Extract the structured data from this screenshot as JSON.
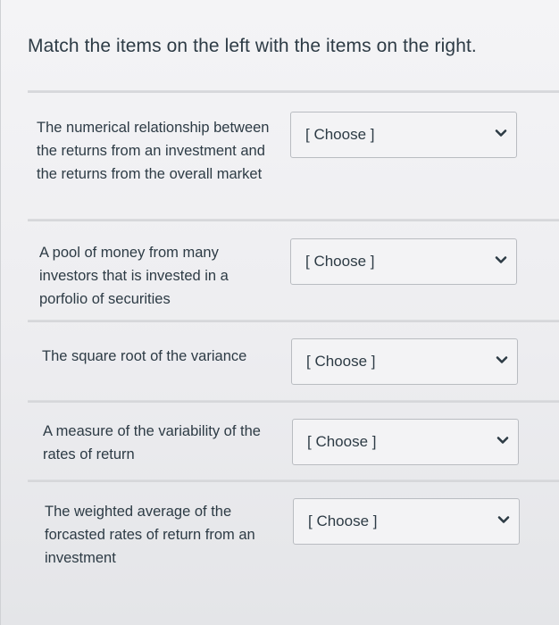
{
  "question_text": "Match the items on the left with the items on the right.",
  "rows": [
    {
      "prompt": "The numerical relationship between the returns from an investment and the returns from the overall market",
      "select_value": "[ Choose ]"
    },
    {
      "prompt": "A pool of money from many investors that is invested in a porfolio of securities",
      "select_value": "[ Choose ]"
    },
    {
      "prompt": "The square root of the variance",
      "select_value": "[ Choose ]"
    },
    {
      "prompt": "A measure of the variability of the rates of return",
      "select_value": "[ Choose ]"
    },
    {
      "prompt": "The weighted average of the forcasted rates of return from an investment",
      "select_value": "[ Choose ]"
    }
  ],
  "icons": {
    "dropdown": "chevron-down-icon"
  },
  "colors": {
    "text": "#2d3b45",
    "background": "#f0f0f2",
    "select_border": "#b9bcc1"
  }
}
